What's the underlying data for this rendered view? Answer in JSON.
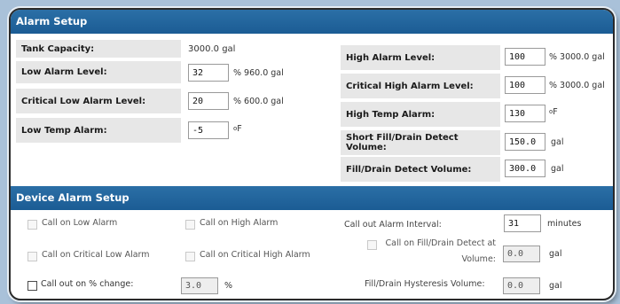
{
  "alarm_setup": {
    "title": "Alarm Setup",
    "left": {
      "tank_capacity_label": "Tank Capacity:",
      "tank_capacity_value": "3000.0",
      "tank_capacity_unit": "gal",
      "low_alarm_label": "Low Alarm Level:",
      "low_alarm_value": "32",
      "low_alarm_unit": "% 960.0 gal",
      "critical_low_label": "Critical Low Alarm Level:",
      "critical_low_value": "20",
      "critical_low_unit": "% 600.0 gal",
      "low_temp_label": "Low Temp Alarm:",
      "low_temp_value": "-5",
      "low_temp_unit": "F"
    },
    "right": {
      "high_alarm_label": "High Alarm Level:",
      "high_alarm_value": "100",
      "high_alarm_unit": "% 3000.0 gal",
      "critical_high_label": "Critical High Alarm Level:",
      "critical_high_value": "100",
      "critical_high_unit": "% 3000.0 gal",
      "high_temp_label": "High Temp Alarm:",
      "high_temp_value": "130",
      "high_temp_unit": "F",
      "short_fill_label": "Short Fill/Drain Detect Volume:",
      "short_fill_value": "150.0",
      "short_fill_unit": "gal",
      "fill_drain_label": "Fill/Drain Detect Volume:",
      "fill_drain_value": "300.0",
      "fill_drain_unit": "gal"
    }
  },
  "device_alarm_setup": {
    "title": "Device Alarm Setup",
    "call_low_label": "Call on Low Alarm",
    "call_high_label": "Call on High Alarm",
    "call_critical_low_label": "Call on Critical Low Alarm",
    "call_critical_high_label": "Call on Critical High Alarm",
    "call_percent_label": "Call out on % change:",
    "call_percent_value": "3.0",
    "call_percent_unit": "%",
    "interval_label": "Call out Alarm Interval:",
    "interval_value": "31",
    "interval_unit": "minutes",
    "call_fill_drain_label_1": "Call on Fill/Drain Detect at",
    "call_fill_drain_label_2": "Volume:",
    "call_fill_drain_value": "0.0",
    "call_fill_drain_unit": "gal",
    "hysteresis_label": "Fill/Drain Hysteresis Volume:",
    "hysteresis_value": "0.0",
    "hysteresis_unit": "gal"
  }
}
